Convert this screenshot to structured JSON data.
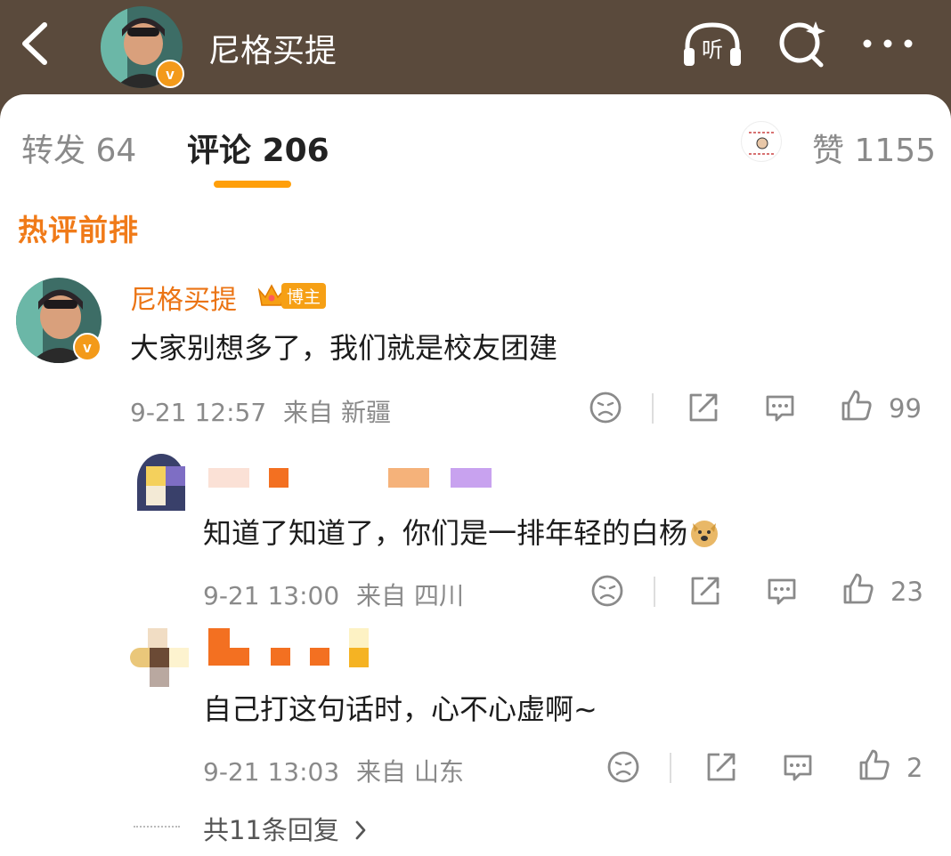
{
  "header": {
    "title": "尼格买提",
    "listen_label": "听"
  },
  "tabs": {
    "repost": "转发 64",
    "comments": "评论 206",
    "likes": "赞 1155"
  },
  "section": {
    "title": "热评前排"
  },
  "comments": [
    {
      "username": "尼格买提",
      "badge": "博主",
      "text": "大家别想多了，我们就是校友团建",
      "time": "9-21 12:57",
      "from": "来自",
      "location": "新疆",
      "likes": "99"
    },
    {
      "text": "知道了知道了，你们是一排年轻的白杨",
      "time": "9-21 13:00",
      "from": "来自",
      "location": "四川",
      "likes": "23"
    },
    {
      "text": "自己打这句话时，心不心虚啊~",
      "time": "9-21 13:03",
      "from": "来自",
      "location": "山东",
      "likes": "2"
    }
  ],
  "replies_link": "共11条回复",
  "colors": {
    "header_bg": "#5a4a3c",
    "accent_orange": "#eb7414",
    "tab_underline": "#ff9f0a",
    "verified": "#f39a1a"
  }
}
